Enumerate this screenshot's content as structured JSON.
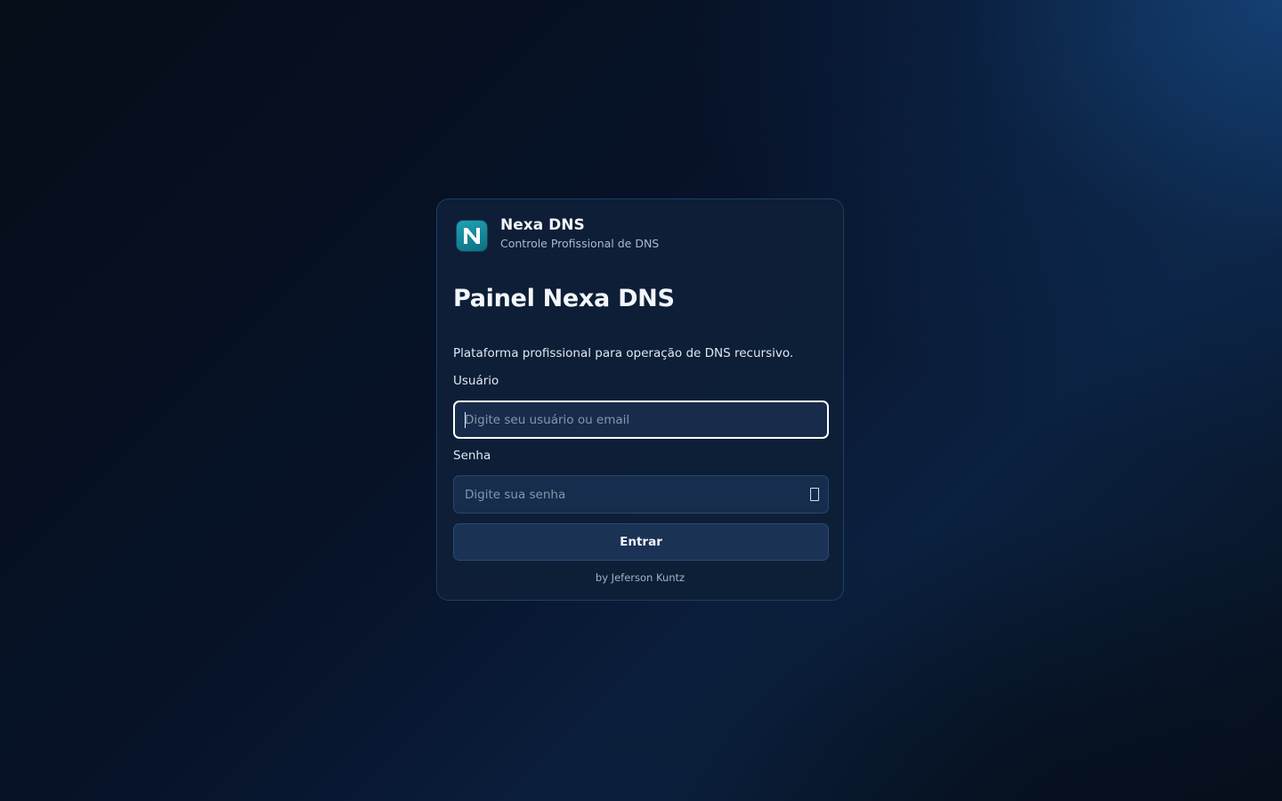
{
  "brand": {
    "logo_letter": "N",
    "name": "Nexa DNS",
    "tagline": "Controle Profissional de DNS"
  },
  "login": {
    "title": "Painel Nexa DNS",
    "description": "Plataforma profissional para operação de DNS recursivo.",
    "username_label": "Usuário",
    "username_placeholder": "Digite seu usuário ou email",
    "username_value": "",
    "password_label": "Senha",
    "password_placeholder": "Digite sua senha",
    "password_value": "",
    "submit_label": "Entrar",
    "footer": "by Jeferson Kuntz"
  },
  "colors": {
    "accent_logo": "#1fa3b3",
    "card_bg": "#0e1f37",
    "input_bg": "#172d4d",
    "button_bg": "#1a3354"
  },
  "icons": {
    "password_toggle": "eye-icon"
  }
}
